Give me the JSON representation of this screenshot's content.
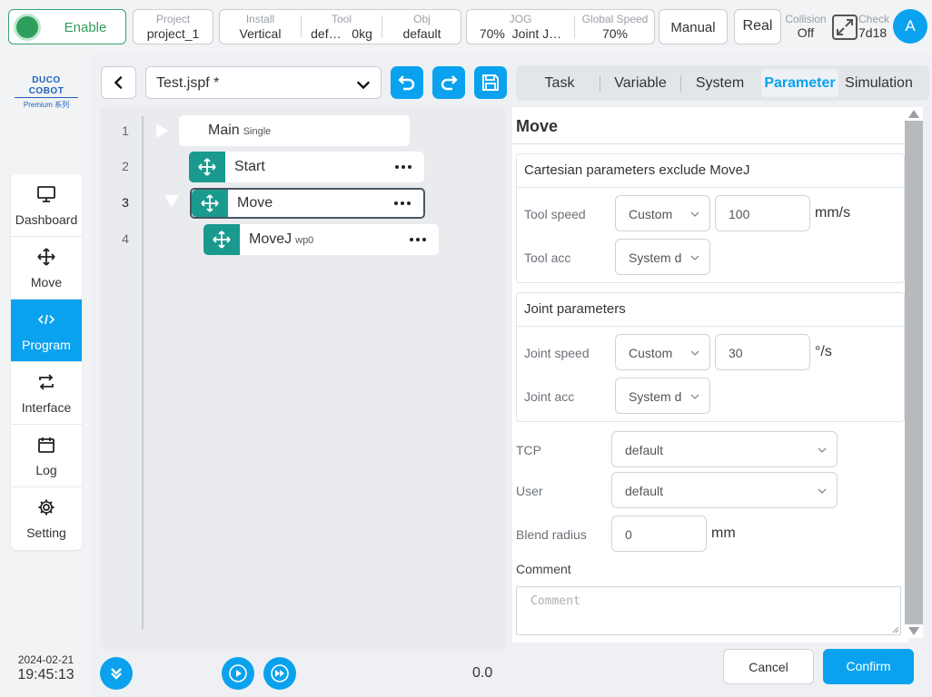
{
  "topbar": {
    "enable_label": "Enable",
    "project": {
      "key": "Project",
      "value": "project_1"
    },
    "install": {
      "key": "Install",
      "value": "Vertical"
    },
    "tool": {
      "key": "Tool",
      "value": "def…",
      "weight": "0kg"
    },
    "obj": {
      "key": "Obj",
      "value": "default"
    },
    "jog": {
      "key": "JOG",
      "percent": "70%",
      "mode": "Joint J…"
    },
    "global_speed": {
      "key": "Global Speed",
      "value": "70%"
    },
    "manual_label": "Manual",
    "real_label": "Real",
    "collision": {
      "key": "Collision",
      "value": "Off"
    },
    "check": {
      "key": "Check",
      "value": "7d18"
    },
    "avatar_letter": "A"
  },
  "brand": {
    "line1": "DUCO COBOT",
    "line2": "Premium 系列"
  },
  "nav": [
    {
      "label": "Dashboard",
      "active": false
    },
    {
      "label": "Move",
      "active": false
    },
    {
      "label": "Program",
      "active": true
    },
    {
      "label": "Interface",
      "active": false
    },
    {
      "label": "Log",
      "active": false
    },
    {
      "label": "Setting",
      "active": false
    }
  ],
  "datetime": {
    "date": "2024-02-21",
    "time": "19:45:13"
  },
  "editor": {
    "file_name": "Test.jspf *",
    "lines": [
      "1",
      "2",
      "3",
      "4"
    ],
    "nodes": [
      {
        "name": "Main",
        "sub": "Single"
      },
      {
        "name": "Start",
        "sub": ""
      },
      {
        "name": "Move",
        "sub": ""
      },
      {
        "name": "MoveJ",
        "sub": "wp0"
      }
    ],
    "run_value": "0.0"
  },
  "tabs": [
    "Task",
    "Variable",
    "System",
    "Parameter",
    "Simulation"
  ],
  "active_tab": "Parameter",
  "panel": {
    "title": "Move",
    "cartesian": {
      "header": "Cartesian parameters exclude MoveJ",
      "tool_speed_label": "Tool speed",
      "tool_speed_mode": "Custom",
      "tool_speed_value": "100",
      "tool_speed_unit": "mm/s",
      "tool_acc_label": "Tool acc",
      "tool_acc_mode": "System d"
    },
    "joint": {
      "header": "Joint parameters",
      "joint_speed_label": "Joint speed",
      "joint_speed_mode": "Custom",
      "joint_speed_value": "30",
      "joint_speed_unit": "°/s",
      "joint_acc_label": "Joint acc",
      "joint_acc_mode": "System d"
    },
    "tcp_label": "TCP",
    "tcp_value": "default",
    "user_label": "User",
    "user_value": "default",
    "blend_label": "Blend radius",
    "blend_value": "0",
    "blend_unit": "mm",
    "comment_label": "Comment",
    "comment_placeholder": "Comment"
  },
  "footer": {
    "cancel_label": "Cancel",
    "confirm_label": "Confirm"
  },
  "colors": {
    "accent": "#0aa2ee",
    "teal": "#1a9a8e",
    "enable_green": "#2e9e5c"
  }
}
